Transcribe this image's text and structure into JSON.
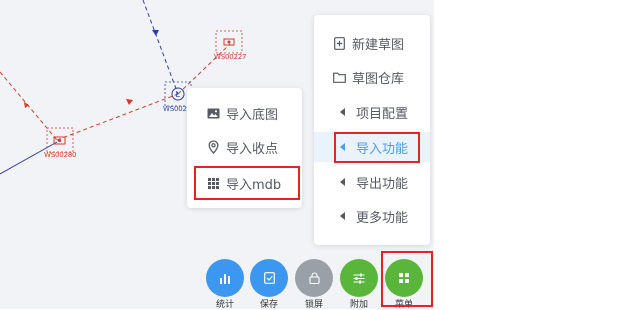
{
  "map": {
    "nodes": [
      {
        "id": "ws1",
        "label": "WS00227"
      },
      {
        "id": "ws2",
        "label": "WS0022"
      },
      {
        "id": "ws3",
        "label": "WS00280"
      }
    ],
    "colors": {
      "red_line": "#d33b2c",
      "blue_line": "#2c3fa8",
      "node_box": "#d33b2c"
    }
  },
  "submenu": {
    "items": [
      {
        "label": "导入底图",
        "icon": "image-icon"
      },
      {
        "label": "导入收点",
        "icon": "location-pin-icon"
      },
      {
        "label": "导入mdb",
        "icon": "grid-icon"
      }
    ]
  },
  "menu": {
    "items": [
      {
        "label": "新建草图",
        "icon": "new-file-icon"
      },
      {
        "label": "草图仓库",
        "icon": "folder-icon"
      },
      {
        "label": "项目配置",
        "icon": "caret-left-icon"
      },
      {
        "label": "导入功能",
        "icon": "caret-left-icon",
        "active": true
      },
      {
        "label": "导出功能",
        "icon": "caret-left-icon"
      },
      {
        "label": "更多功能",
        "icon": "caret-left-icon"
      }
    ]
  },
  "toolbar": {
    "buttons": [
      {
        "label": "统计",
        "icon": "bar-chart-icon",
        "color": "#3b97f0"
      },
      {
        "label": "保存",
        "icon": "save-icon",
        "color": "#3b97f0"
      },
      {
        "label": "锁屏",
        "icon": "lock-icon",
        "color": "#9aa0a8"
      },
      {
        "label": "附加",
        "icon": "sliders-icon",
        "color": "#5ab63a"
      },
      {
        "label": "菜单",
        "icon": "apps-icon",
        "color": "#5ab63a"
      }
    ]
  },
  "colors": {
    "accent": "#4a9ee8",
    "highlight": "#e8221f"
  }
}
